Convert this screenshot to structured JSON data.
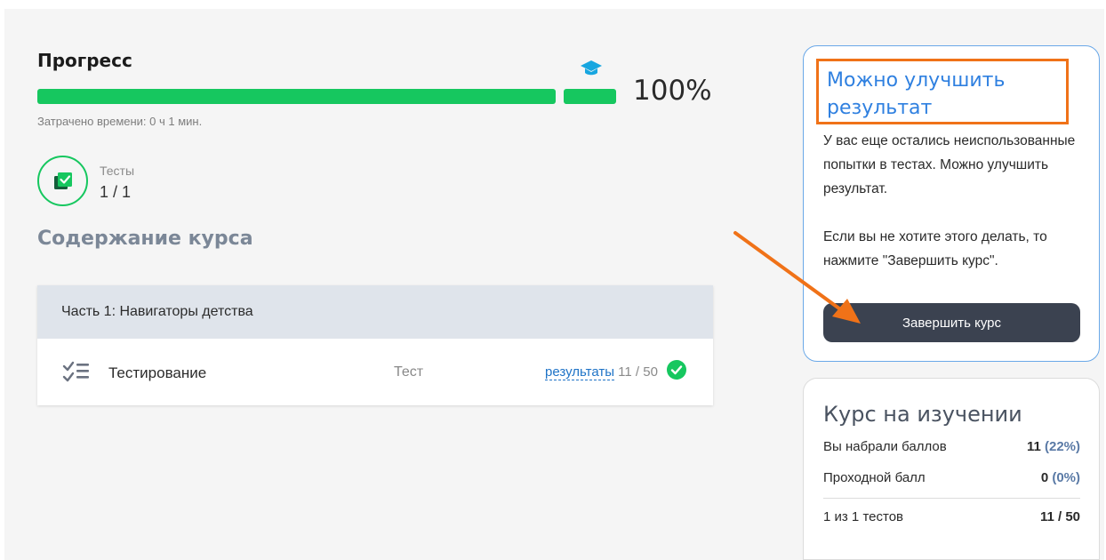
{
  "progress": {
    "title": "Прогресс",
    "percent_label": "100%",
    "percent_value": 100,
    "time_spent": "Затрачено времени: 0 ч 1 мин."
  },
  "tests_stat": {
    "label": "Тесты",
    "value": "1 / 1"
  },
  "course_content": {
    "title": "Содержание курса",
    "section_title": "Часть 1: Навигаторы детства",
    "items": [
      {
        "title": "Тестирование",
        "type": "Тест",
        "results_link": "результаты",
        "score": "11 / 50"
      }
    ]
  },
  "improve_card": {
    "title": "Можно улучшить результат",
    "text1": "У вас еще остались неиспользованные попытки в тестах. Можно улучшить результат.",
    "text2": "Если вы не хотите этого делать, то нажмите \"Завершить курс\".",
    "button_label": "Завершить курс"
  },
  "study_card": {
    "title": "Курс на изучении",
    "rows": [
      {
        "label": "Вы набрали баллов",
        "value": "11",
        "pct": "(22%)"
      },
      {
        "label": "Проходной балл",
        "value": "0",
        "pct": "(0%)"
      },
      {
        "label": "1 из 1 тестов",
        "value": "11 / 50",
        "pct": ""
      }
    ]
  },
  "colors": {
    "progress_green": "#16c75f",
    "accent_blue": "#2f80e0",
    "annotation_orange": "#f07218",
    "button_dark": "#3b4250"
  }
}
